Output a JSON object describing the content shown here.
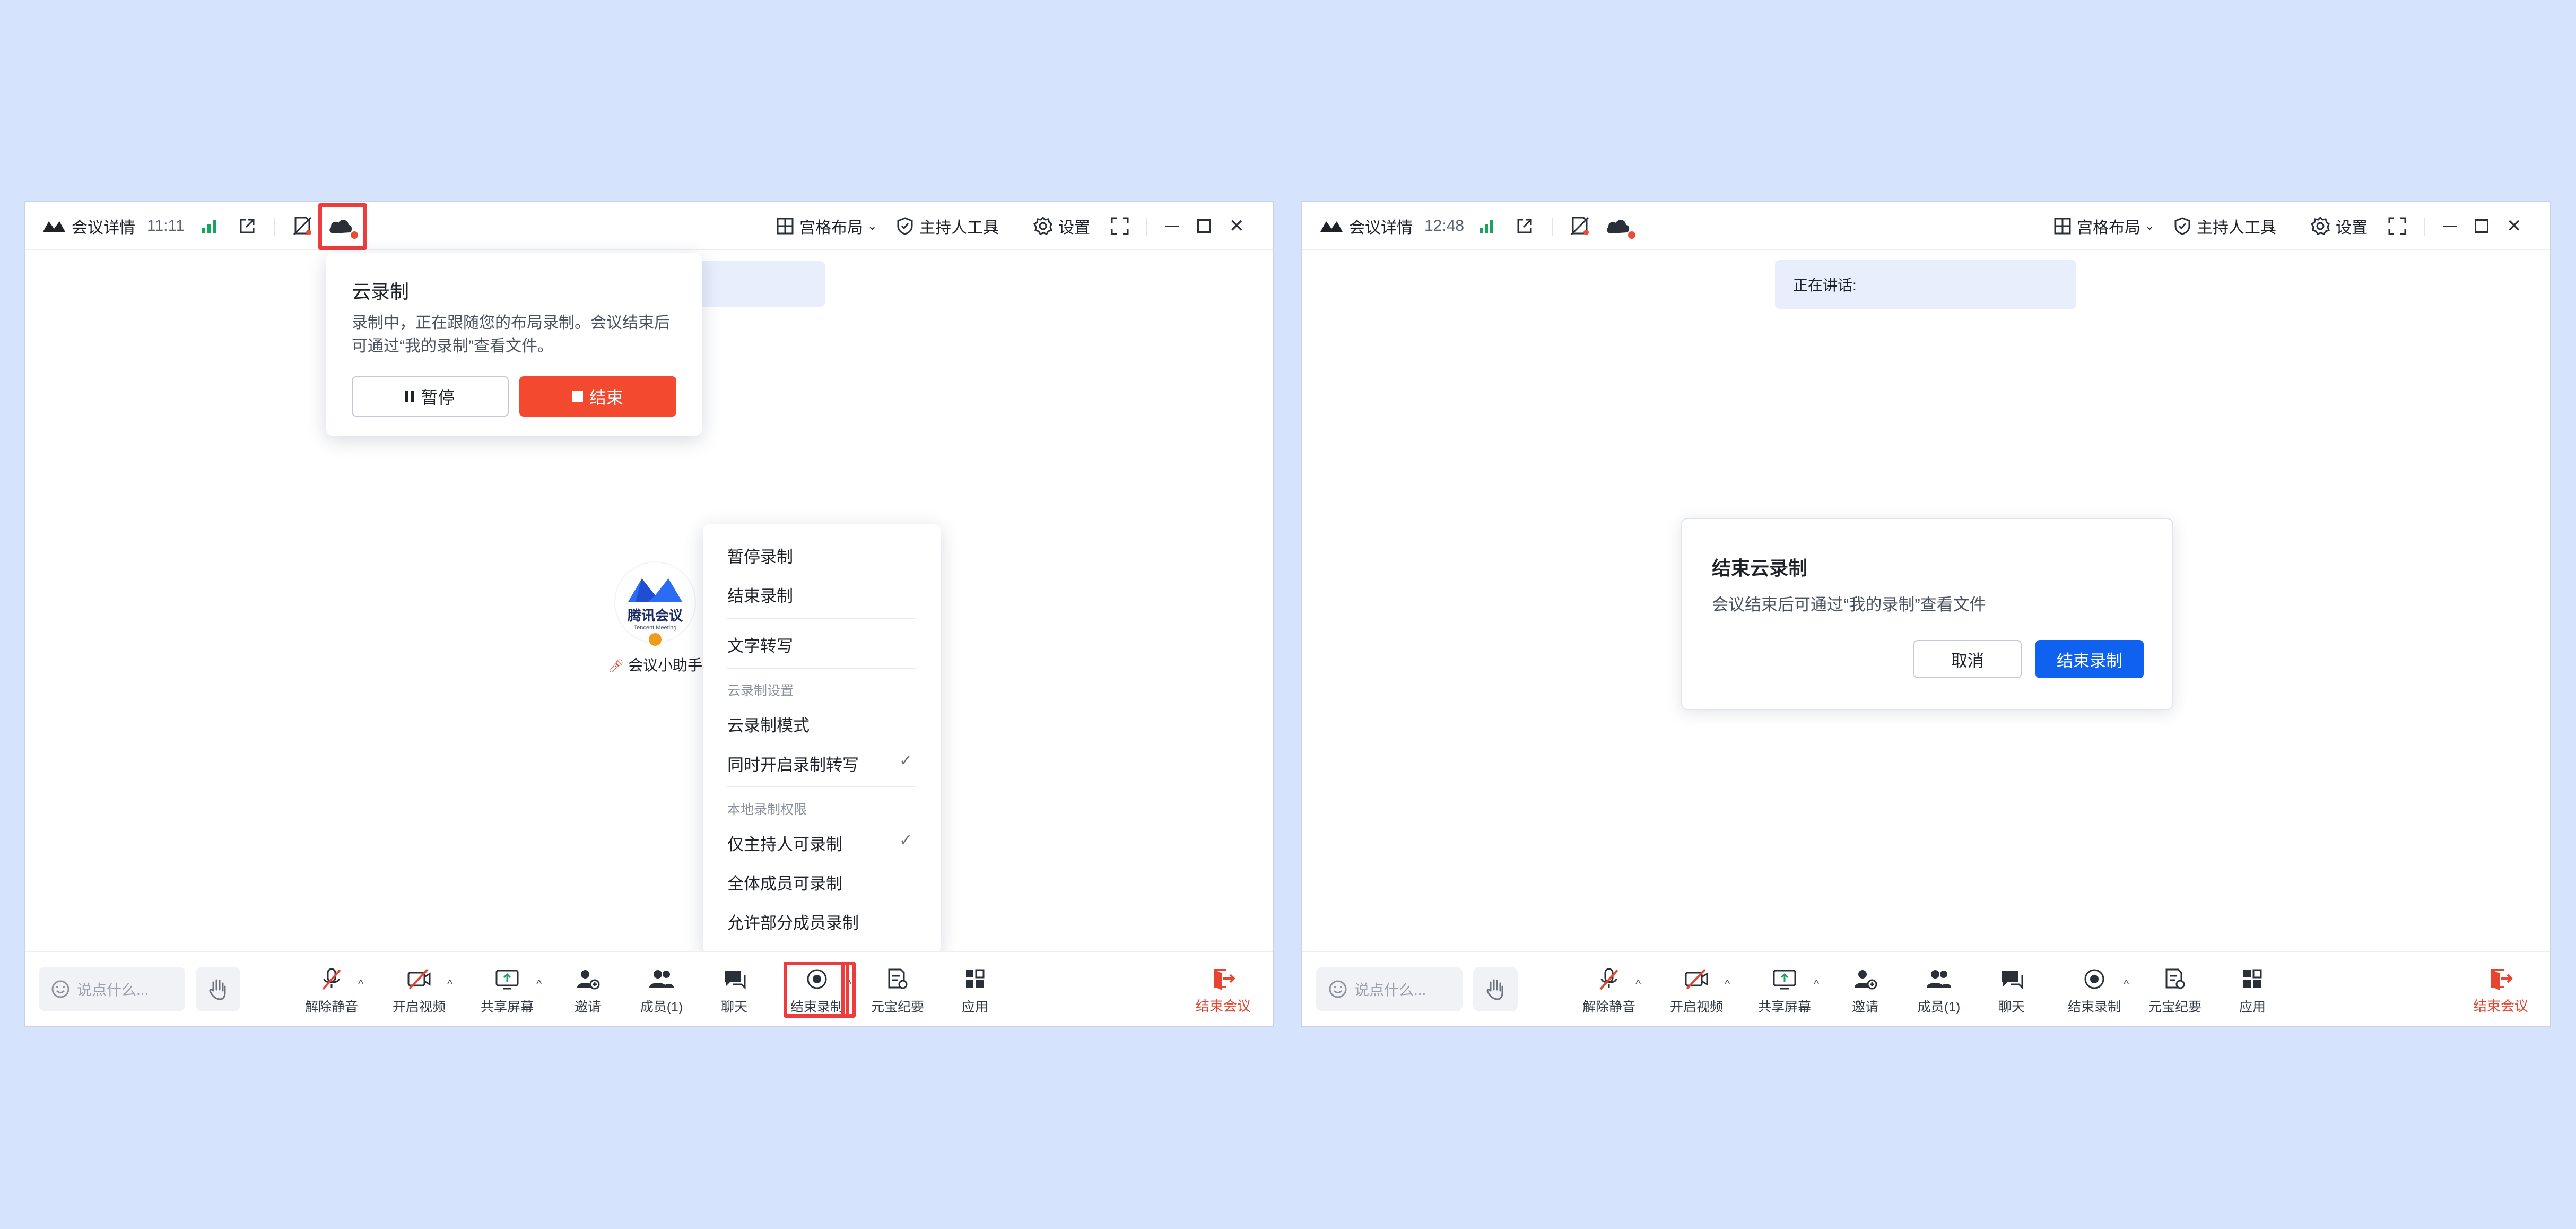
{
  "colors": {
    "background": "#d6e3fc",
    "accent_blue": "#0f62f0",
    "danger_red": "#f2492f",
    "signal_green": "#19a35c",
    "highlight_red": "#ee3c3c"
  },
  "left_window": {
    "title_bar": {
      "meeting_info": "会议详情",
      "time": "11:11",
      "layout": "宫格布局",
      "host_tools": "主持人工具",
      "settings": "设置"
    },
    "cloud_popover": {
      "title": "云录制",
      "description": "录制中，正在跟随您的布局录制。会议结束后可通过“我的录制”查看文件。",
      "pause_label": "暂停",
      "stop_label": "结束"
    },
    "assistant": {
      "logo_text": "腾讯会议",
      "logo_subtext": "Tencent Meeting",
      "name": "会议小助手"
    },
    "record_menu": {
      "items_top": [
        "暂停录制",
        "结束录制"
      ],
      "transcription": "文字转写",
      "cloud_settings_header": "云录制设置",
      "cloud_mode": "云录制模式",
      "sync_transcribe": "同时开启录制转写",
      "local_permission_header": "本地录制权限",
      "host_only": "仅主持人可录制",
      "all_members": "全体成员可录制",
      "allow_some": "允许部分成员录制"
    },
    "toolbar": {
      "chat_placeholder": "说点什么...",
      "unmute": "解除静音",
      "start_video": "开启视频",
      "share_screen": "共享屏幕",
      "invite": "邀请",
      "members": "成员(1)",
      "chat": "聊天",
      "end_recording": "结束录制",
      "ai_minutes": "元宝纪要",
      "apps": "应用",
      "end_meeting": "结束会议"
    }
  },
  "right_window": {
    "title_bar": {
      "meeting_info": "会议详情",
      "time": "12:48",
      "layout": "宫格布局",
      "host_tools": "主持人工具",
      "settings": "设置"
    },
    "speaking_label": "正在讲话:",
    "dialog": {
      "title": "结束云录制",
      "description": "会议结束后可通过“我的录制”查看文件",
      "cancel": "取消",
      "confirm": "结束录制"
    },
    "toolbar": {
      "chat_placeholder": "说点什么...",
      "unmute": "解除静音",
      "start_video": "开启视频",
      "share_screen": "共享屏幕",
      "invite": "邀请",
      "members": "成员(1)",
      "chat": "聊天",
      "end_recording": "结束录制",
      "ai_minutes": "元宝纪要",
      "apps": "应用",
      "end_meeting": "结束会议"
    }
  }
}
